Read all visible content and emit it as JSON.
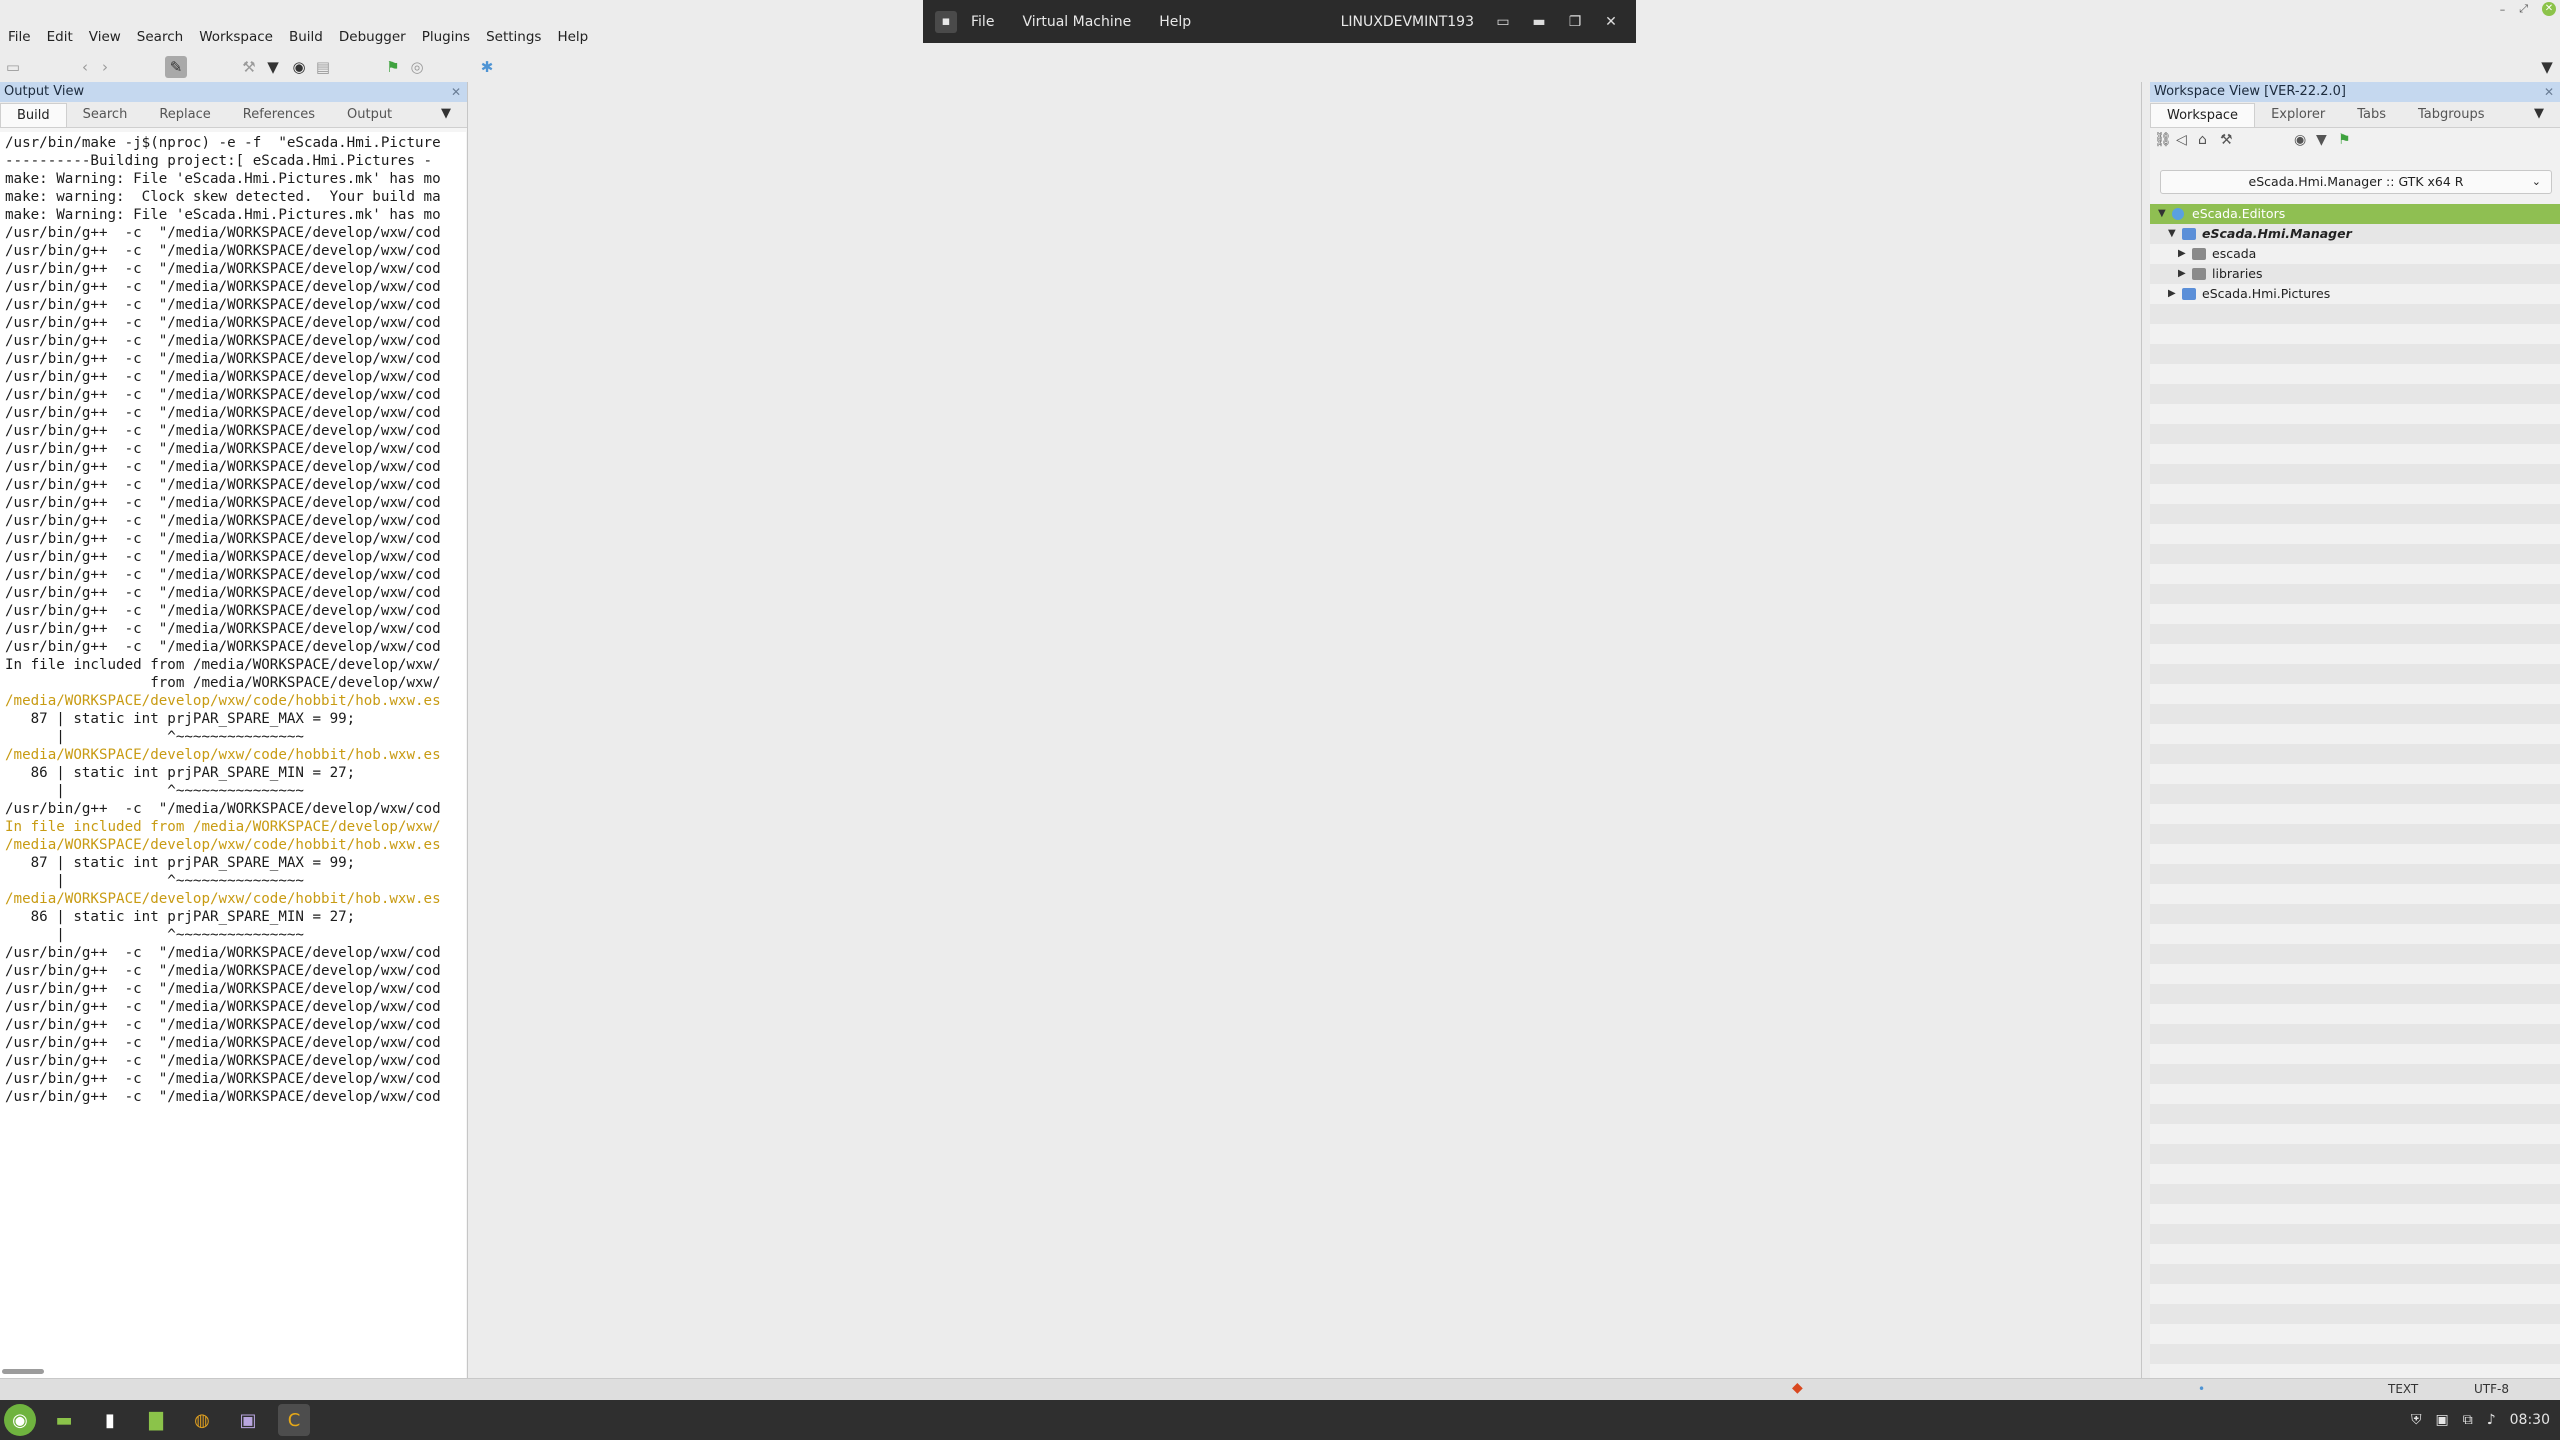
{
  "menubar": {
    "items": [
      "File",
      "Edit",
      "View",
      "Search",
      "Workspace",
      "Build",
      "Debugger",
      "Plugins",
      "Settings",
      "Help"
    ]
  },
  "vm_bar": {
    "items": [
      "File",
      "Virtual Machine",
      "Help"
    ],
    "host": "LINUXDEVMINT193"
  },
  "output_view": {
    "title": "Output View",
    "tabs": [
      "Build",
      "Search",
      "Replace",
      "References",
      "Output"
    ],
    "active_tab": "Build",
    "log": [
      {
        "t": "/usr/bin/make -j$(nproc) -e -f  \"eScada.Hmi.Picture",
        "warn": false
      },
      {
        "t": "----------Building project:[ eScada.Hmi.Pictures -",
        "warn": false
      },
      {
        "t": "make: Warning: File 'eScada.Hmi.Pictures.mk' has mo",
        "warn": false
      },
      {
        "t": "make: warning:  Clock skew detected.  Your build ma",
        "warn": false
      },
      {
        "t": "make: Warning: File 'eScada.Hmi.Pictures.mk' has mo",
        "warn": false
      },
      {
        "t": "/usr/bin/g++  -c  \"/media/WORKSPACE/develop/wxw/cod",
        "warn": false
      },
      {
        "t": "/usr/bin/g++  -c  \"/media/WORKSPACE/develop/wxw/cod",
        "warn": false
      },
      {
        "t": "/usr/bin/g++  -c  \"/media/WORKSPACE/develop/wxw/cod",
        "warn": false
      },
      {
        "t": "/usr/bin/g++  -c  \"/media/WORKSPACE/develop/wxw/cod",
        "warn": false
      },
      {
        "t": "/usr/bin/g++  -c  \"/media/WORKSPACE/develop/wxw/cod",
        "warn": false
      },
      {
        "t": "/usr/bin/g++  -c  \"/media/WORKSPACE/develop/wxw/cod",
        "warn": false
      },
      {
        "t": "/usr/bin/g++  -c  \"/media/WORKSPACE/develop/wxw/cod",
        "warn": false
      },
      {
        "t": "/usr/bin/g++  -c  \"/media/WORKSPACE/develop/wxw/cod",
        "warn": false
      },
      {
        "t": "/usr/bin/g++  -c  \"/media/WORKSPACE/develop/wxw/cod",
        "warn": false
      },
      {
        "t": "/usr/bin/g++  -c  \"/media/WORKSPACE/develop/wxw/cod",
        "warn": false
      },
      {
        "t": "/usr/bin/g++  -c  \"/media/WORKSPACE/develop/wxw/cod",
        "warn": false
      },
      {
        "t": "/usr/bin/g++  -c  \"/media/WORKSPACE/develop/wxw/cod",
        "warn": false
      },
      {
        "t": "/usr/bin/g++  -c  \"/media/WORKSPACE/develop/wxw/cod",
        "warn": false
      },
      {
        "t": "/usr/bin/g++  -c  \"/media/WORKSPACE/develop/wxw/cod",
        "warn": false
      },
      {
        "t": "/usr/bin/g++  -c  \"/media/WORKSPACE/develop/wxw/cod",
        "warn": false
      },
      {
        "t": "/usr/bin/g++  -c  \"/media/WORKSPACE/develop/wxw/cod",
        "warn": false
      },
      {
        "t": "/usr/bin/g++  -c  \"/media/WORKSPACE/develop/wxw/cod",
        "warn": false
      },
      {
        "t": "/usr/bin/g++  -c  \"/media/WORKSPACE/develop/wxw/cod",
        "warn": false
      },
      {
        "t": "/usr/bin/g++  -c  \"/media/WORKSPACE/develop/wxw/cod",
        "warn": false
      },
      {
        "t": "/usr/bin/g++  -c  \"/media/WORKSPACE/develop/wxw/cod",
        "warn": false
      },
      {
        "t": "/usr/bin/g++  -c  \"/media/WORKSPACE/develop/wxw/cod",
        "warn": false
      },
      {
        "t": "/usr/bin/g++  -c  \"/media/WORKSPACE/develop/wxw/cod",
        "warn": false
      },
      {
        "t": "/usr/bin/g++  -c  \"/media/WORKSPACE/develop/wxw/cod",
        "warn": false
      },
      {
        "t": "/usr/bin/g++  -c  \"/media/WORKSPACE/develop/wxw/cod",
        "warn": false
      },
      {
        "t": "In file included from /media/WORKSPACE/develop/wxw/",
        "warn": false
      },
      {
        "t": "                 from /media/WORKSPACE/develop/wxw/",
        "warn": false
      },
      {
        "t": "/media/WORKSPACE/develop/wxw/code/hobbit/hob.wxw.es",
        "warn": true
      },
      {
        "t": "   87 | static int prjPAR_SPARE_MAX = 99;",
        "warn": false
      },
      {
        "t": "      |            ^~~~~~~~~~~~~~~~",
        "warn": false
      },
      {
        "t": "/media/WORKSPACE/develop/wxw/code/hobbit/hob.wxw.es",
        "warn": true
      },
      {
        "t": "   86 | static int prjPAR_SPARE_MIN = 27;",
        "warn": false
      },
      {
        "t": "      |            ^~~~~~~~~~~~~~~~",
        "warn": false
      },
      {
        "t": "/usr/bin/g++  -c  \"/media/WORKSPACE/develop/wxw/cod",
        "warn": false
      },
      {
        "t": "In file included from /media/WORKSPACE/develop/wxw/",
        "warn": true
      },
      {
        "t": "/media/WORKSPACE/develop/wxw/code/hobbit/hob.wxw.es",
        "warn": true
      },
      {
        "t": "   87 | static int prjPAR_SPARE_MAX = 99;",
        "warn": false
      },
      {
        "t": "      |            ^~~~~~~~~~~~~~~~",
        "warn": false
      },
      {
        "t": "/media/WORKSPACE/develop/wxw/code/hobbit/hob.wxw.es",
        "warn": true
      },
      {
        "t": "   86 | static int prjPAR_SPARE_MIN = 27;",
        "warn": false
      },
      {
        "t": "      |            ^~~~~~~~~~~~~~~~",
        "warn": false
      },
      {
        "t": "/usr/bin/g++  -c  \"/media/WORKSPACE/develop/wxw/cod",
        "warn": false
      },
      {
        "t": "/usr/bin/g++  -c  \"/media/WORKSPACE/develop/wxw/cod",
        "warn": false
      },
      {
        "t": "/usr/bin/g++  -c  \"/media/WORKSPACE/develop/wxw/cod",
        "warn": false
      },
      {
        "t": "/usr/bin/g++  -c  \"/media/WORKSPACE/develop/wxw/cod",
        "warn": false
      },
      {
        "t": "/usr/bin/g++  -c  \"/media/WORKSPACE/develop/wxw/cod",
        "warn": false
      },
      {
        "t": "/usr/bin/g++  -c  \"/media/WORKSPACE/develop/wxw/cod",
        "warn": false
      },
      {
        "t": "/usr/bin/g++  -c  \"/media/WORKSPACE/develop/wxw/cod",
        "warn": false
      },
      {
        "t": "/usr/bin/g++  -c  \"/media/WORKSPACE/develop/wxw/cod",
        "warn": false
      },
      {
        "t": "/usr/bin/g++  -c  \"/media/WORKSPACE/develop/wxw/cod",
        "warn": false
      }
    ]
  },
  "workspace_view": {
    "title": "Workspace View [VER-22.2.0]",
    "tabs": [
      "Workspace",
      "Explorer",
      "Tabs",
      "Tabgroups"
    ],
    "active_tab": "Workspace",
    "config": "eScada.Hmi.Manager :: GTK x64 R",
    "tree": [
      {
        "label": "eScada.Editors",
        "level": 0,
        "expanded": true,
        "selected": true,
        "bold": false,
        "kind": "workspace"
      },
      {
        "label": "eScada.Hmi.Manager",
        "level": 1,
        "expanded": true,
        "selected": false,
        "bold": true,
        "kind": "project"
      },
      {
        "label": "escada",
        "level": 2,
        "expanded": false,
        "selected": false,
        "bold": false,
        "kind": "folder"
      },
      {
        "label": "libraries",
        "level": 2,
        "expanded": false,
        "selected": false,
        "bold": false,
        "kind": "folder"
      },
      {
        "label": "eScada.Hmi.Pictures",
        "level": 1,
        "expanded": false,
        "selected": false,
        "bold": false,
        "kind": "project"
      }
    ]
  },
  "statusbar": {
    "mode": "TEXT",
    "encoding": "UTF-8"
  },
  "tray": {
    "clock": "08:30"
  },
  "colors": {
    "panel_title_bg": "#c5d8ef",
    "selection_green": "#8fbf52",
    "warning_text": "#c89b13",
    "taskbar_bg": "#2f2f2f"
  }
}
